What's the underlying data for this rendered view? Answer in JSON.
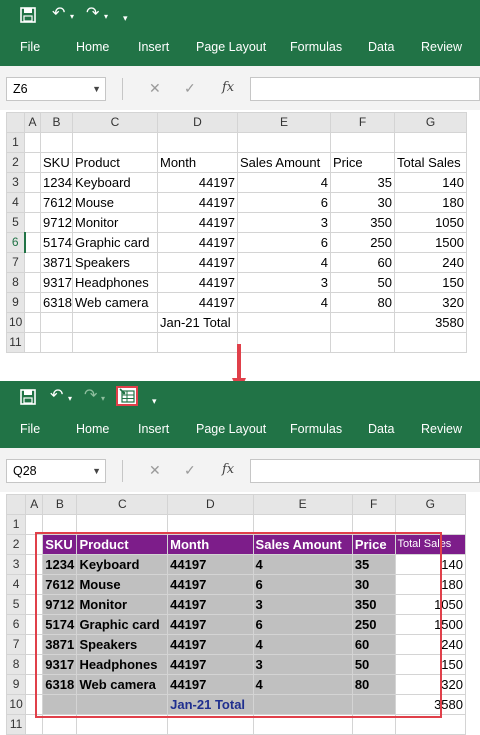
{
  "top": {
    "ribbon_tabs": [
      "File",
      "Home",
      "Insert",
      "Page Layout",
      "Formulas",
      "Data",
      "Review"
    ],
    "name_box": "Z6",
    "fx": "fx",
    "col_headers": [
      "A",
      "B",
      "C",
      "D",
      "E",
      "F",
      "G"
    ],
    "row_numbers": [
      "1",
      "2",
      "3",
      "4",
      "5",
      "6",
      "7",
      "8",
      "9",
      "10",
      "11"
    ],
    "headers": [
      "SKU",
      "Product",
      "Month",
      "Sales Amount",
      "Price",
      "Total Sales"
    ],
    "rows": [
      [
        "1234",
        "Keyboard",
        "44197",
        "4",
        "35",
        "140"
      ],
      [
        "7612",
        "Mouse",
        "44197",
        "6",
        "30",
        "180"
      ],
      [
        "9712",
        "Monitor",
        "44197",
        "3",
        "350",
        "1050"
      ],
      [
        "5174",
        "Graphic card",
        "44197",
        "6",
        "250",
        "1500"
      ],
      [
        "3871",
        "Speakers",
        "44197",
        "4",
        "60",
        "240"
      ],
      [
        "9317",
        "Headphones",
        "44197",
        "3",
        "50",
        "150"
      ],
      [
        "6318",
        "Web camera",
        "44197",
        "4",
        "80",
        "320"
      ]
    ],
    "total_label": "Jan-21 Total",
    "total_value": "3580"
  },
  "bottom": {
    "ribbon_tabs": [
      "File",
      "Home",
      "Insert",
      "Page Layout",
      "Formulas",
      "Data",
      "Review"
    ],
    "name_box": "Q28",
    "fx": "fx",
    "col_headers": [
      "A",
      "B",
      "C",
      "D",
      "E",
      "F",
      "G"
    ],
    "row_numbers": [
      "1",
      "2",
      "3",
      "4",
      "5",
      "6",
      "7",
      "8",
      "9",
      "10",
      "11"
    ],
    "headers": [
      "SKU",
      "Product",
      "Month",
      "Sales Amount",
      "Price",
      "Total Sales"
    ],
    "rows": [
      [
        "1234",
        "Keyboard",
        "44197",
        "4",
        "35",
        "140"
      ],
      [
        "7612",
        "Mouse",
        "44197",
        "6",
        "30",
        "180"
      ],
      [
        "9712",
        "Monitor",
        "44197",
        "3",
        "350",
        "1050"
      ],
      [
        "5174",
        "Graphic card",
        "44197",
        "6",
        "250",
        "1500"
      ],
      [
        "3871",
        "Speakers",
        "44197",
        "4",
        "60",
        "240"
      ],
      [
        "9317",
        "Headphones",
        "44197",
        "3",
        "50",
        "150"
      ],
      [
        "6318",
        "Web camera",
        "44197",
        "4",
        "80",
        "320"
      ]
    ],
    "total_label": "Jan-21 Total",
    "total_value": "3580"
  },
  "colors": {
    "ribbon": "#217346",
    "header_purple": "#7d1d8a",
    "highlight_red": "#e0404a",
    "total_blue": "#1f2f8f"
  },
  "icons": [
    "save-icon",
    "undo-icon",
    "redo-icon",
    "customize-qat-icon",
    "autoformat-icon",
    "cancel-icon",
    "enter-icon",
    "insert-function-icon",
    "down-arrow-icon"
  ]
}
